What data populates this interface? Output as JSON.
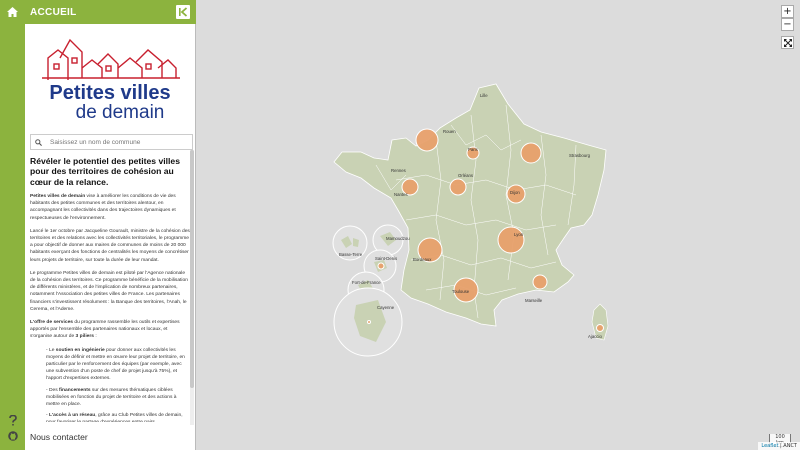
{
  "panel": {
    "title": "ACCUEIL",
    "logo_line1": "Petites villes",
    "logo_line2": "de demain",
    "search_placeholder": "Saisissez un nom de commune",
    "heading": "Révéler le potentiel des petites villes pour des territoires de cohésion au cœur de la relance.",
    "p1_bold": "Petites villes de demain",
    "p1_rest": " vise à améliorer les conditions de vie des habitants des petites communes et des territoires alentour, en accompagnant les collectivités dans des trajectoires dynamiques et respectueuses de l'environnement.",
    "p2": "Lancé le 1er octobre par Jacqueline Gourault, ministre de la cohésion des territoires et des relations avec les collectivités territoriales, le programme a pour objectif de donner aux maires de communes de moins de 20 000 habitants exerçant des fonctions de centralités les moyens de concrétiser leurs projets de territoire, sur toute la durée de leur mandat.",
    "p3": "Le programme Petites villes de demain est piloté par l'Agence nationale de la cohésion des territoires. Ce programme bénéficie de la mobilisation de différents ministères, et de l'implication de nombreux partenaires, notamment l'Association des petites villes de France. Les partenaires financiers s'investissent résolument : la Banque des territoires, l'Anah, le Cerema, et l'Ademe.",
    "p4_bold": "L'offre de services",
    "p4_rest1": " du programme rassemble les outils et expertises apportés par l'ensemble des partenaires nationaux et locaux, et s'organise autour de ",
    "p4_bold2": "3 piliers",
    "p4_rest2": " :",
    "li1_pre": "- Le ",
    "li1_bold": "soutien en ingénierie",
    "li1_rest": " pour donner aux collectivités les moyens de définir et mettre en œuvre leur projet de territoire, en particulier par le renforcement des équipes (par exemple, avec une subvention d'un poste de chef de projet jusqu'à 75%), et l'apport d'expertises externes.",
    "li2_pre": "- Des ",
    "li2_bold": "financements",
    "li2_rest": " sur des mesures thématiques ciblées mobilisées en fonction du projet de territoire et des actions à mettre en place.",
    "li3_pre": "- ",
    "li3_bold": "L'accès à un réseau",
    "li3_rest": ", grâce au Club Petites villes de demain, pour favoriser le partage d'expériences entre pairs.",
    "contact": "Nous contacter"
  },
  "rail": {
    "home_icon": "home-icon",
    "help_icon": "question-icon",
    "github_icon": "github-icon"
  },
  "map": {
    "zoom_in": "+",
    "zoom_out": "−",
    "fullscreen_icon": "fullscreen-icon",
    "scale": "100 km",
    "attribution_leaflet": "Leaflet",
    "attribution_sep": " | ",
    "attribution_anct": "ANCT",
    "cities": [
      "Lille",
      "Rouen",
      "Paris",
      "Strasbourg",
      "Rennes",
      "Orléans",
      "Nantes",
      "Dijon",
      "Lyon",
      "Bordeaux",
      "Toulouse",
      "Marseille",
      "Ajaccio",
      "Basse-Terre",
      "Saint-Denis",
      "Mamoudzou",
      "Fort-de-France",
      "Cayenne"
    ]
  },
  "colors": {
    "accent": "#8cb33e",
    "logo_blue": "#1f3a8a",
    "logo_red": "#c8202f",
    "bubble": "#e8a06b",
    "land": "#c9d2b4"
  }
}
